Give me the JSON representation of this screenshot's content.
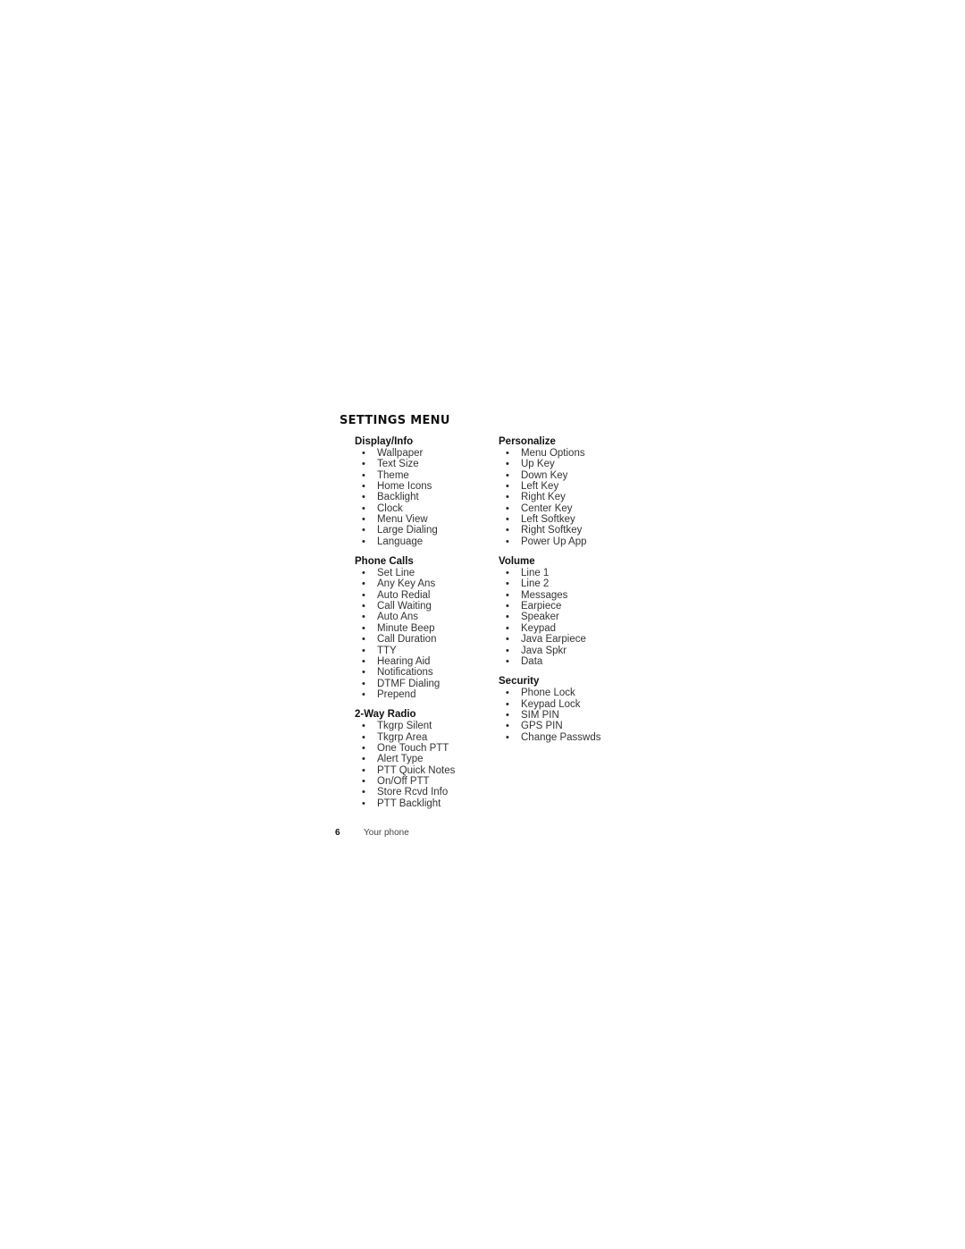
{
  "page_title": "SETTINGS MENU",
  "columns": [
    [
      {
        "heading": "Display/Info",
        "items": [
          "Wallpaper",
          "Text Size",
          "Theme",
          "Home Icons",
          "Backlight",
          "Clock",
          "Menu View",
          "Large Dialing",
          "Language"
        ]
      },
      {
        "heading": "Phone Calls",
        "items": [
          "Set Line",
          "Any Key Ans",
          "Auto Redial",
          "Call Waiting",
          "Auto Ans",
          "Minute Beep",
          "Call Duration",
          "TTY",
          "Hearing Aid",
          "Notifications",
          "DTMF Dialing",
          "Prepend"
        ]
      },
      {
        "heading": "2-Way Radio",
        "items": [
          "Tkgrp Silent",
          "Tkgrp Area",
          "One Touch PTT",
          "Alert Type",
          "PTT Quick Notes",
          "On/Off PTT",
          "Store Rcvd Info",
          "PTT Backlight"
        ]
      }
    ],
    [
      {
        "heading": "Personalize",
        "items": [
          "Menu Options",
          "Up Key",
          "Down Key",
          "Left Key",
          "Right Key",
          "Center Key",
          "Left Softkey",
          "Right Softkey",
          "Power Up App"
        ]
      },
      {
        "heading": "Volume",
        "items": [
          "Line 1",
          "Line 2",
          "Messages",
          "Earpiece",
          "Speaker",
          "Keypad",
          "Java Earpiece",
          "Java Spkr",
          "Data"
        ]
      },
      {
        "heading": "Security",
        "items": [
          "Phone Lock",
          "Keypad Lock",
          "SIM PIN",
          "GPS PIN",
          "Change Passwds"
        ]
      }
    ]
  ],
  "footer": {
    "page_number": "6",
    "section": "Your phone"
  }
}
